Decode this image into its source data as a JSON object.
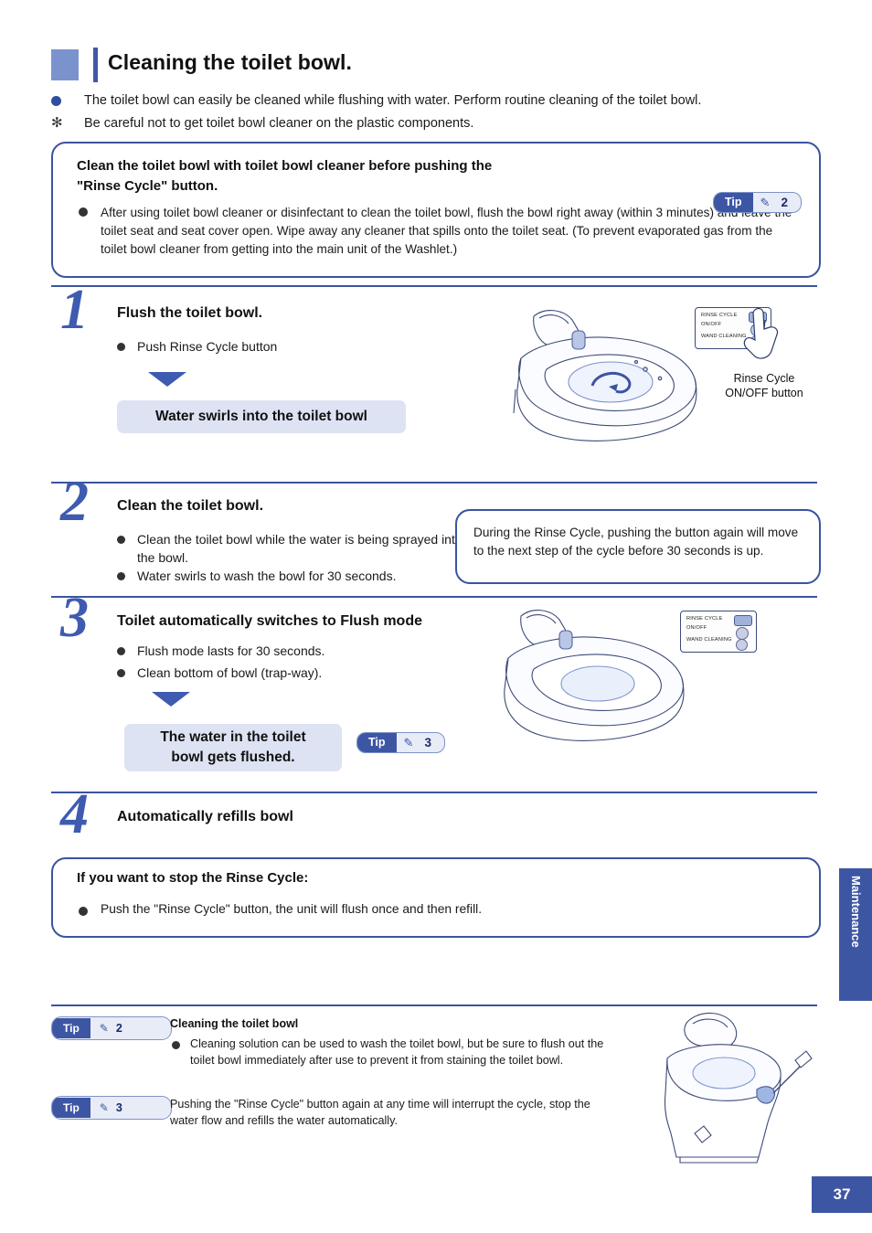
{
  "header": {
    "title": "Cleaning the toilet bowl.",
    "intro_bullet": "The toilet bowl can easily be cleaned while flushing with water. Perform routine cleaning of the toilet bowl.",
    "intro_note_mark": "✻",
    "intro_note": "Be careful not to get toilet bowl cleaner on the plastic components."
  },
  "notice": {
    "heading_line1": "Clean the toilet bowl with toilet bowl cleaner before pushing the",
    "heading_line2": "\"Rinse Cycle\" button.",
    "body": "After using toilet bowl cleaner or disinfectant to clean the toilet bowl, flush the bowl right away (within 3 minutes) and leave the toilet seat and seat cover open. Wipe away any cleaner that spills onto the toilet seat. (To prevent evaporated gas from the toilet bowl cleaner from getting into the main unit of the Washlet.)",
    "tip_label": "Tip",
    "tip_icon": "pen-icon",
    "tip_number": "2"
  },
  "steps": [
    {
      "number": "1",
      "title": "Flush the toilet bowl.",
      "items": [
        "Push Rinse Cycle button"
      ],
      "result": "Water swirls into the toilet bowl",
      "caption_line1": "Rinse Cycle",
      "caption_line2": "ON/OFF button"
    },
    {
      "number": "2",
      "title": "Clean the toilet bowl.",
      "items": [
        "Clean the toilet bowl while the water is being sprayed into the bowl.",
        "Water swirls to wash the bowl for 30 seconds."
      ],
      "callout": "During the Rinse Cycle, pushing the button again will move to the next step of the cycle before 30 seconds is  up."
    },
    {
      "number": "3",
      "title": "Toilet automatically switches to Flush mode",
      "items": [
        "Flush mode lasts for 30 seconds.",
        "Clean bottom of bowl (trap-way)."
      ],
      "result_line1": "The water in the toilet",
      "result_line2": "bowl gets flushed.",
      "tip_label": "Tip",
      "tip_icon": "pen-icon",
      "tip_number": "3"
    },
    {
      "number": "4",
      "title": "Automatically refills bowl"
    }
  ],
  "stop_box": {
    "heading": "If you  want to stop the Rinse Cycle:",
    "body": "Push the \"Rinse Cycle\" button, the unit will flush once and then refill."
  },
  "remote": {
    "row1": "RINSE CYCLE",
    "row2": "ON/OFF",
    "row3": "WAND CLEANING"
  },
  "bottom_tips": [
    {
      "label": "Tip",
      "icon": "pen-icon",
      "number": "2",
      "heading": "Cleaning the toilet bowl",
      "text": "Cleaning solution can be used to wash the toilet bowl, but be sure to flush out the toilet bowl immediately after use to prevent it from staining the toilet bowl."
    },
    {
      "label": "Tip",
      "icon": "pen-icon",
      "number": "3",
      "heading": "",
      "text": "Pushing the \"Rinse Cycle\" button again at any time will interrupt the cycle, stop the water flow and refills the water automatically."
    }
  ],
  "side_tab": "Maintenance",
  "page_number": "37",
  "colors": {
    "accent": "#3d56a4",
    "step_blue": "#3f5bb0",
    "result_bg": "#dde3f3"
  }
}
